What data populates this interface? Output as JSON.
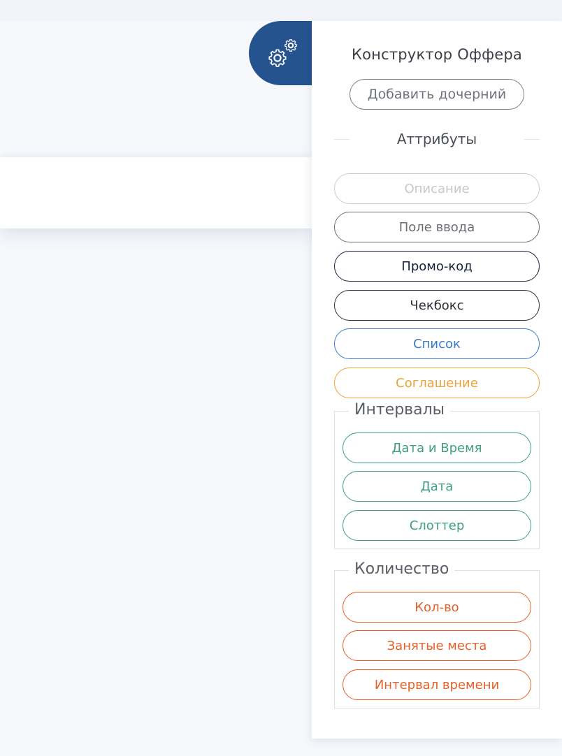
{
  "panel": {
    "title": "Конструктор Оффера",
    "add_child_label": "Добавить дочерний",
    "attributes_heading": "Аттрибуты"
  },
  "attributes": [
    {
      "label": "Описание",
      "color": "#c9ccd2",
      "text_color": "#c5c8cd"
    },
    {
      "label": "Поле ввода",
      "color": "#6a6e74",
      "text_color": "#6a6e74"
    },
    {
      "label": "Промо-код",
      "color": "#15233c",
      "text_color": "#15233c"
    },
    {
      "label": "Чекбокс",
      "color": "#2d3036",
      "text_color": "#2d3036"
    },
    {
      "label": "Список",
      "color": "#3a7bc8",
      "text_color": "#3a7bc8"
    },
    {
      "label": "Соглашение",
      "color": "#eba23a",
      "text_color": "#eba23a"
    }
  ],
  "intervals": {
    "title": "Интервалы",
    "color": "#3f9e84",
    "items": [
      "Дата и Время",
      "Дата",
      "Слоттер"
    ]
  },
  "quantity": {
    "title": "Количество",
    "color": "#e7602a",
    "items": [
      "Кол-во",
      "Занятые места",
      "Интервал времени"
    ]
  },
  "icons": {
    "settings": "gears-icon"
  },
  "colors": {
    "accent": "#24538f",
    "background": "#f7f8fc"
  }
}
